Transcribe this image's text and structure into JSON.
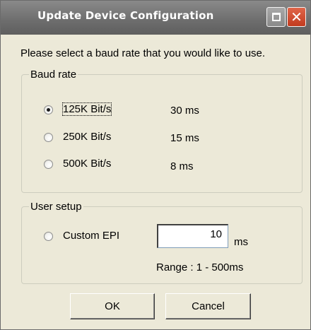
{
  "window": {
    "title": "Update Device Configuration",
    "maximize_icon": "maximize-icon",
    "close_icon": "close-icon",
    "close_glyph": "✕"
  },
  "instruction": "Please select a baud rate that you would like to use.",
  "baud_group": {
    "legend": "Baud rate",
    "options": [
      {
        "label": "125K Bit/s",
        "timing": "30 ms",
        "checked": true
      },
      {
        "label": "250K Bit/s",
        "timing": "15 ms",
        "checked": false
      },
      {
        "label": "500K Bit/s",
        "timing": "8 ms",
        "checked": false
      }
    ]
  },
  "user_group": {
    "legend": "User setup",
    "custom_label": "Custom EPI",
    "custom_checked": false,
    "epi_value": "10",
    "unit": "ms",
    "range": "Range : 1 - 500ms"
  },
  "buttons": {
    "ok": "OK",
    "cancel": "Cancel"
  }
}
